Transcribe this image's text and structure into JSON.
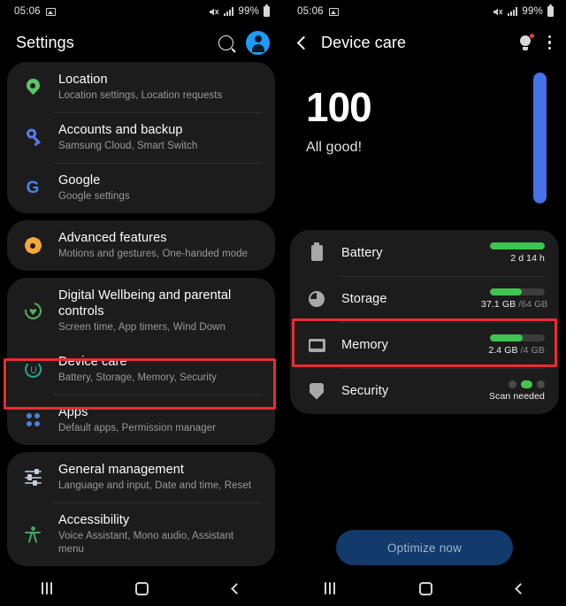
{
  "statusbar": {
    "time": "05:06",
    "battery_percent": "99%",
    "icons": [
      "photo-icon",
      "mute-icon",
      "signal-icon",
      "battery-icon"
    ]
  },
  "left_phone": {
    "header": {
      "title": "Settings",
      "search_icon": "search-icon",
      "avatar": "account-avatar"
    },
    "groups": [
      {
        "items": [
          {
            "icon": "location-pin-icon",
            "title": "Location",
            "subtitle": "Location settings, Location requests"
          },
          {
            "icon": "key-icon",
            "title": "Accounts and backup",
            "subtitle": "Samsung Cloud, Smart Switch"
          },
          {
            "icon": "google-g-icon",
            "title": "Google",
            "subtitle": "Google settings"
          }
        ]
      },
      {
        "items": [
          {
            "icon": "gear-flower-icon",
            "title": "Advanced features",
            "subtitle": "Motions and gestures, One-handed mode"
          }
        ]
      },
      {
        "items": [
          {
            "icon": "heart-circle-icon",
            "title": "Digital Wellbeing and parental controls",
            "subtitle": "Screen time, App timers, Wind Down"
          },
          {
            "icon": "device-care-icon",
            "title": "Device care",
            "subtitle": "Battery, Storage, Memory, Security",
            "highlighted": true
          },
          {
            "icon": "apps-grid-icon",
            "title": "Apps",
            "subtitle": "Default apps, Permission manager"
          }
        ]
      },
      {
        "items": [
          {
            "icon": "sliders-icon",
            "title": "General management",
            "subtitle": "Language and input, Date and time, Reset"
          },
          {
            "icon": "accessibility-icon",
            "title": "Accessibility",
            "subtitle": "Voice Assistant, Mono audio, Assistant menu"
          }
        ]
      }
    ]
  },
  "right_phone": {
    "header": {
      "back_icon": "back-arrow-icon",
      "title": "Device care",
      "bulb_icon": "lightbulb-icon",
      "menu_icon": "more-options-icon"
    },
    "score": {
      "value": "100",
      "status": "All good!",
      "bar_color": "#4472e8"
    },
    "items": [
      {
        "icon": "battery-icon",
        "label": "Battery",
        "value": "2 d 14 h",
        "value_dim": "",
        "fill_percent": 100,
        "highlighted": true
      },
      {
        "icon": "storage-pie-icon",
        "label": "Storage",
        "value": "37.1 GB",
        "value_dim": " /64 GB",
        "fill_percent": 58,
        "highlighted": false
      },
      {
        "icon": "memory-chip-icon",
        "label": "Memory",
        "value": "2.4 GB",
        "value_dim": " /4 GB",
        "fill_percent": 60,
        "highlighted": false
      },
      {
        "icon": "shield-icon",
        "label": "Security",
        "value": "Scan needed",
        "value_dim": "",
        "indicator": "dots",
        "highlighted": false
      }
    ],
    "optimize_button": "Optimize now"
  },
  "navbar": {
    "recent_icon": "recent-apps-icon",
    "home_icon": "home-icon",
    "back_icon": "back-icon"
  },
  "colors": {
    "accent_green": "#3ec451",
    "accent_blue": "#4472e8",
    "highlight_red": "#ee2b32",
    "card_bg": "#1c1c1c"
  }
}
